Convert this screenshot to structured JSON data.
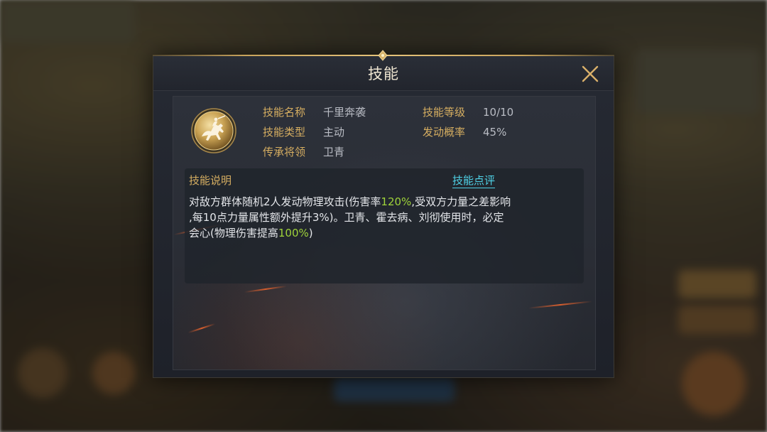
{
  "dialog": {
    "title": "技能"
  },
  "skill": {
    "icon": "horseman-emblem-icon",
    "fields": [
      {
        "label": "技能名称",
        "value": "千里奔袭"
      },
      {
        "label": "技能等级",
        "value": "10/10"
      },
      {
        "label": "技能类型",
        "value": "主动"
      },
      {
        "label": "发动概率",
        "value": "45%"
      },
      {
        "label": "传承将领",
        "value": "卫青"
      }
    ]
  },
  "description": {
    "label": "技能说明",
    "review_link": "技能点评",
    "line1_a": "对敌方群体随机2人发动物理攻击(伤害率",
    "line1_hl": "120%",
    "line1_b": ",受双方力量之差影响",
    "line2": ",每10点力量属性额外提升3%)。卫青、霍去病、刘彻使用时，必定",
    "line3_a": "会心(物理伤害提高",
    "line3_hl": "100%",
    "line3_b": ")"
  },
  "colors": {
    "gold": "#d6ae61",
    "cyan_link": "#4fd1e6",
    "green_highlight": "#9fd33a"
  }
}
